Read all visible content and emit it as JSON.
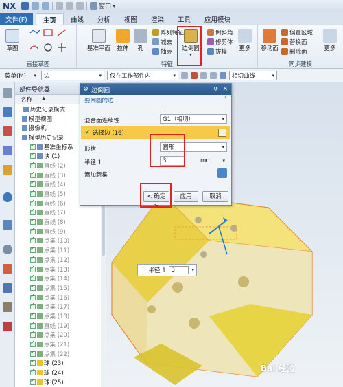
{
  "titlebar": {
    "logo": "NX",
    "window_menu": "窗口"
  },
  "tabs": {
    "file": "文件(F)",
    "home": "主页",
    "curve": "曲线",
    "analysis": "分析",
    "view": "视图",
    "render": "渲染",
    "tools": "工具",
    "apps": "应用模块"
  },
  "ribbon": {
    "sketch": "草图",
    "direct_sketch_label": "直接草图",
    "datum_plane": "基准平面",
    "extrude": "拉伸",
    "hole": "孔",
    "pattern_feature": "阵列特征",
    "subtract": "减去",
    "shell": "抽壳",
    "edge_blend": "边倒圆",
    "chamfer": "倒斜角",
    "trim_body": "修剪体",
    "draft": "拔模",
    "more": "更多",
    "feature_label": "特征",
    "move_face": "移动面",
    "offset_region": "偏置区域",
    "replace_face": "替换面",
    "delete_face": "删除面",
    "more2": "更多",
    "sync_label": "同步建模"
  },
  "selbar": {
    "menu": "菜单(M)",
    "filter": "边",
    "scope": "仅在工作部件内",
    "curve_rule": "相切曲线"
  },
  "navigator": {
    "title": "部件导航器",
    "col_name": "名称",
    "rows": [
      {
        "label": "历史记录模式",
        "kind": "plain"
      },
      {
        "label": "模型视图",
        "kind": "plain"
      },
      {
        "label": "摄像机",
        "kind": "plain"
      },
      {
        "label": "模型历史记录",
        "kind": "plain"
      },
      {
        "label": "基准坐标系",
        "kind": "check"
      },
      {
        "label": "块 (1)",
        "kind": "check"
      },
      {
        "label": "直线 (2)",
        "kind": "gray"
      },
      {
        "label": "直线 (3)",
        "kind": "gray"
      },
      {
        "label": "直线 (4)",
        "kind": "gray"
      },
      {
        "label": "直线 (5)",
        "kind": "gray"
      },
      {
        "label": "直线 (6)",
        "kind": "gray"
      },
      {
        "label": "直线 (7)",
        "kind": "gray"
      },
      {
        "label": "直线 (8)",
        "kind": "gray"
      },
      {
        "label": "直线 (9)",
        "kind": "gray"
      },
      {
        "label": "点集 (10)",
        "kind": "gray"
      },
      {
        "label": "点集 (11)",
        "kind": "gray"
      },
      {
        "label": "点集 (12)",
        "kind": "gray"
      },
      {
        "label": "点集 (13)",
        "kind": "gray"
      },
      {
        "label": "点集 (14)",
        "kind": "gray"
      },
      {
        "label": "点集 (15)",
        "kind": "gray"
      },
      {
        "label": "点集 (16)",
        "kind": "gray"
      },
      {
        "label": "点集 (17)",
        "kind": "gray"
      },
      {
        "label": "点集 (18)",
        "kind": "gray"
      },
      {
        "label": "直线 (19)",
        "kind": "gray"
      },
      {
        "label": "点集 (20)",
        "kind": "gray"
      },
      {
        "label": "点集 (21)",
        "kind": "gray"
      },
      {
        "label": "点集 (22)",
        "kind": "gray"
      },
      {
        "label": "球 (23)",
        "kind": "check"
      },
      {
        "label": "球 (24)",
        "kind": "check"
      },
      {
        "label": "球 (25)",
        "kind": "check"
      }
    ]
  },
  "dialog": {
    "title": "边倒圆",
    "section": "要倒圆的边",
    "continuity_label": "混合面连续性",
    "continuity_value": "G1（相切）",
    "select_edge": "选择边 (16)",
    "shape_label": "形状",
    "shape_value": "圆形",
    "radius_label": "半径 1",
    "radius_value": "3",
    "unit": "mm",
    "add_new": "添加新集",
    "ok": "< 确定 >",
    "apply": "应用",
    "cancel": "取消"
  },
  "radius_tag": {
    "label": "半径 1",
    "value": "3"
  },
  "watermark": "Bai 经验",
  "colors": {
    "highlight_red": "#e42222",
    "part_yellow": "#e8d23a",
    "dialog_title": "#2b5a8e"
  }
}
